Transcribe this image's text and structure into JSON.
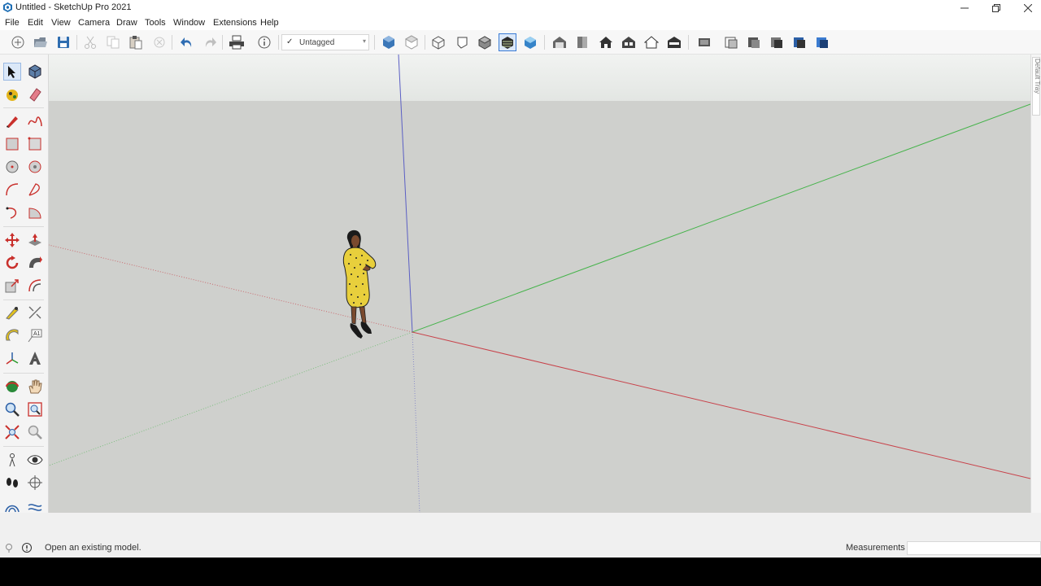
{
  "window": {
    "title": "Untitled - SketchUp Pro 2021"
  },
  "menu": [
    "File",
    "Edit",
    "View",
    "Camera",
    "Draw",
    "Tools",
    "Window",
    "Extensions",
    "Help"
  ],
  "toolbar": {
    "tag_check": "✓",
    "tag_value": "Untagged",
    "icons": [
      "new-icon",
      "open-icon",
      "save-icon",
      "cut-icon",
      "copy-icon",
      "paste-icon",
      "erase-icon",
      "undo-icon",
      "redo-icon",
      "print-icon",
      "model-info-icon",
      "iso-view-icon",
      "top-view-icon",
      "front-view-icon",
      "right-view-icon",
      "back-view-icon",
      "left-view-icon",
      "bottom-view-icon",
      "xray-icon",
      "wireframe-icon",
      "hidden-line-icon",
      "shaded-icon",
      "shaded-textures-icon",
      "warehouse-icon",
      "extension-warehouse-icon",
      "layout-icon",
      "styles-icon",
      "scenes-icon",
      "shadows-icon",
      "fog-icon"
    ]
  },
  "tray": {
    "label": "Default Tray"
  },
  "status": {
    "message": "Open an existing model.",
    "measurements_label": "Measurements",
    "measurements_value": ""
  },
  "colors": {
    "red_axis": "#c8424a",
    "green_axis": "#46b34b",
    "blue_axis": "#5b5fc4",
    "viewport_bg": "#cfd0cd",
    "sky": "#e9ebe9"
  }
}
